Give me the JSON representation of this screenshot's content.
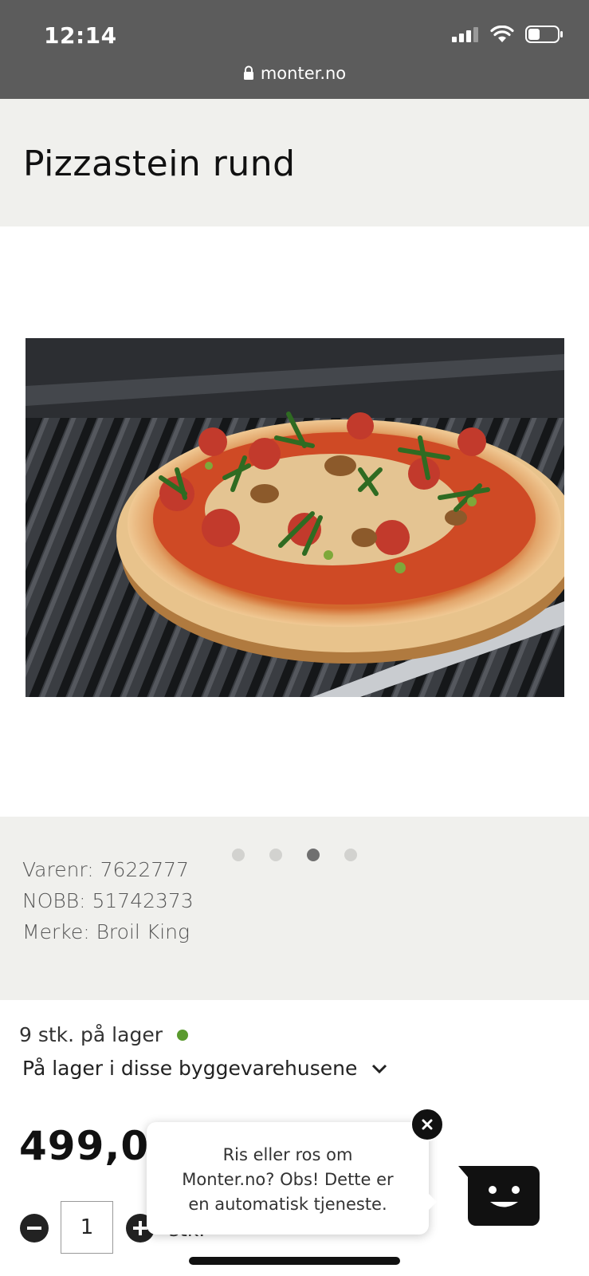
{
  "status_bar": {
    "time": "12:14",
    "url": "monter.no"
  },
  "product": {
    "title": "Pizzastein rund",
    "gallery": {
      "slide_count": 4,
      "active_index": 2
    },
    "specs": [
      "Varenr: 7622777",
      "NOBB: 51742373",
      "Merke: Broil King"
    ],
    "stock_text": "9 stk. på lager",
    "stores_link": "På lager i disse byggevarehusene",
    "price": "499,00",
    "quantity": "1",
    "unit": "stk."
  },
  "chat": {
    "message": [
      "Ris eller ros om",
      "Monter.no? Obs! Dette er",
      "en automatisk tjeneste."
    ]
  },
  "colors": {
    "status_bar": "#5c5c5c",
    "panel": "#f0f0ed",
    "in_stock": "#5a9a2e",
    "dot_active": "#707070",
    "dot_inactive": "#d2d2cf"
  }
}
